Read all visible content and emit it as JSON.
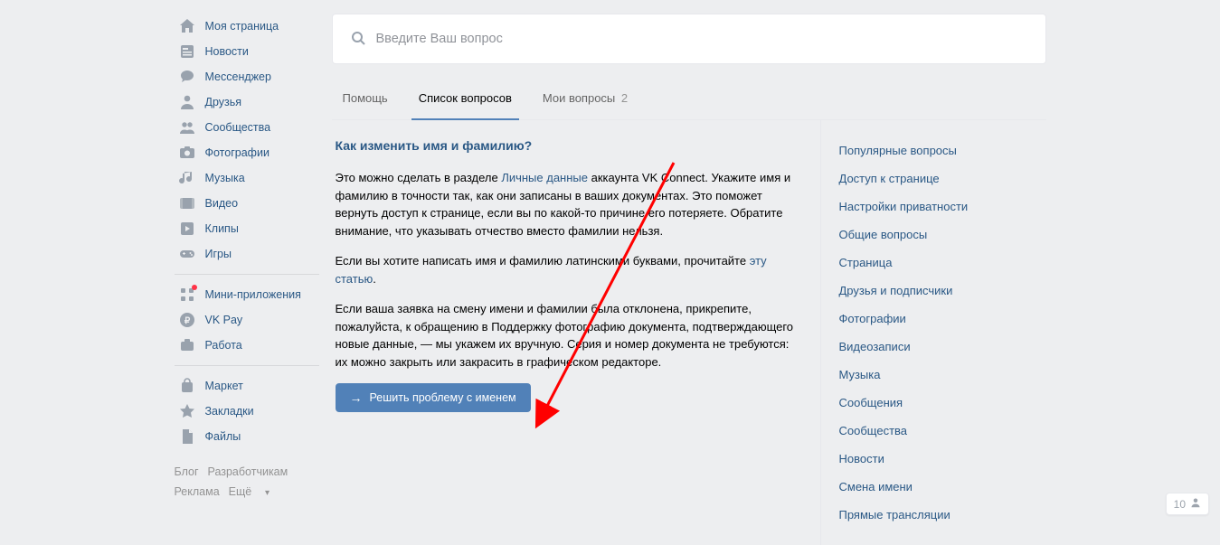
{
  "sidebar": {
    "groups": [
      [
        {
          "icon": "home",
          "label": "Моя страница"
        },
        {
          "icon": "news",
          "label": "Новости"
        },
        {
          "icon": "chat",
          "label": "Мессенджер"
        },
        {
          "icon": "user",
          "label": "Друзья"
        },
        {
          "icon": "users",
          "label": "Сообщества"
        },
        {
          "icon": "camera",
          "label": "Фотографии"
        },
        {
          "icon": "music",
          "label": "Музыка"
        },
        {
          "icon": "video",
          "label": "Видео"
        },
        {
          "icon": "clips",
          "label": "Клипы"
        },
        {
          "icon": "game",
          "label": "Игры"
        }
      ],
      [
        {
          "icon": "apps",
          "label": "Мини-приложения",
          "badge": true
        },
        {
          "icon": "pay",
          "label": "VK Pay"
        },
        {
          "icon": "work",
          "label": "Работа"
        }
      ],
      [
        {
          "icon": "market",
          "label": "Маркет"
        },
        {
          "icon": "bookmark",
          "label": "Закладки"
        },
        {
          "icon": "files",
          "label": "Файлы"
        }
      ]
    ],
    "footer": {
      "row1": [
        "Блог",
        "Разработчикам"
      ],
      "row2_a": "Реклама",
      "row2_b": "Ещё"
    }
  },
  "search": {
    "placeholder": "Введите Ваш вопрос"
  },
  "tabs": [
    {
      "label": "Помощь",
      "active": false
    },
    {
      "label": "Список вопросов",
      "active": true
    },
    {
      "label": "Мои вопросы",
      "count": "2",
      "active": false
    }
  ],
  "article": {
    "title": "Как изменить имя и фамилию?",
    "p1_a": "Это можно сделать в разделе ",
    "p1_link": "Личные данные",
    "p1_b": " аккаунта VK Connect. Укажите имя и фамилию в точности так, как они записаны в ваших документах. Это поможет вернуть доступ к странице, если вы по какой-то причине его потеряете. Обратите внимание, что указывать отчество вместо фамилии нельзя.",
    "p2_a": "Если вы хотите написать имя и фамилию латинскими буквами, прочитайте ",
    "p2_link": "эту статью",
    "p2_b": ".",
    "p3": "Если ваша заявка на смену имени и фамилии была отклонена, прикрепите, пожалуйста, к обращению в Поддержку фотографию документа, подтверждающего новые данные, — мы укажем их вручную. Серия и номер документа не требуются: их можно закрыть или закрасить в графическом редакторе.",
    "button": "Решить проблему с именем"
  },
  "categories": [
    "Популярные вопросы",
    "Доступ к странице",
    "Настройки приватности",
    "Общие вопросы",
    "Страница",
    "Друзья и подписчики",
    "Фотографии",
    "Видеозаписи",
    "Музыка",
    "Сообщения",
    "Сообщества",
    "Новости",
    "Смена имени",
    "Прямые трансляции"
  ],
  "notif": {
    "count": "10"
  }
}
